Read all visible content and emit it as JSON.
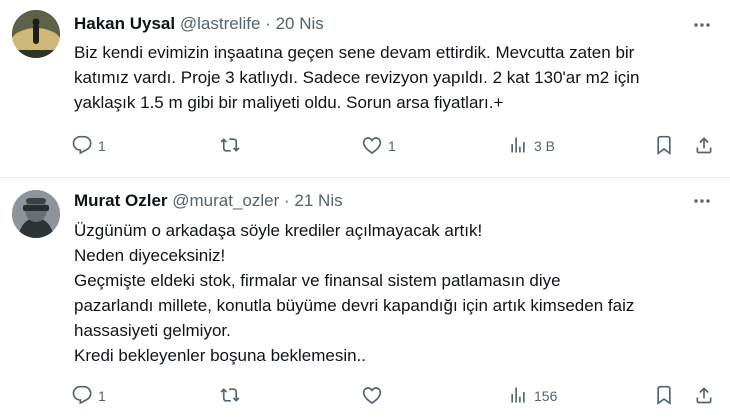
{
  "tweets": [
    {
      "name": "Hakan Uysal",
      "handle": "@lastrelife",
      "separator": "·",
      "date": "20 Nis",
      "lines": [
        "Biz kendi evimizin inşaatına geçen sene devam ettirdik. Mevcutta zaten bir",
        "katımız vardı. Proje 3 katlıydı. Sadece revizyon yapıldı. 2 kat 130'ar m2 için",
        "yaklaşık 1.5 m gibi bir maliyeti oldu. Sorun arsa fiyatları.+"
      ],
      "replies": "1",
      "retweets": "",
      "likes": "1",
      "views": "3 B"
    },
    {
      "name": "Murat Ozler",
      "handle": "@murat_ozler",
      "separator": "·",
      "date": "21 Nis",
      "lines": [
        "Üzgünüm o arkadaşa söyle krediler açılmayacak artık!",
        "Neden diyeceksiniz!",
        "Geçmişte eldeki stok, firmalar ve finansal sistem patlamasın diye",
        "pazarlandı millete, konutla büyüme devri kapandığı için artık kimseden faiz",
        "hassasiyeti gelmiyor.",
        "Kredi bekleyenler boşuna beklemesin.."
      ],
      "replies": "1",
      "retweets": "",
      "likes": "",
      "views": "156"
    }
  ],
  "colors": {
    "text": "#0f1419",
    "muted": "#536471",
    "divider": "#e6ecf0"
  },
  "icons": [
    "more-icon",
    "reply-icon",
    "retweet-icon",
    "like-icon",
    "views-icon",
    "bookmark-icon",
    "share-icon"
  ]
}
